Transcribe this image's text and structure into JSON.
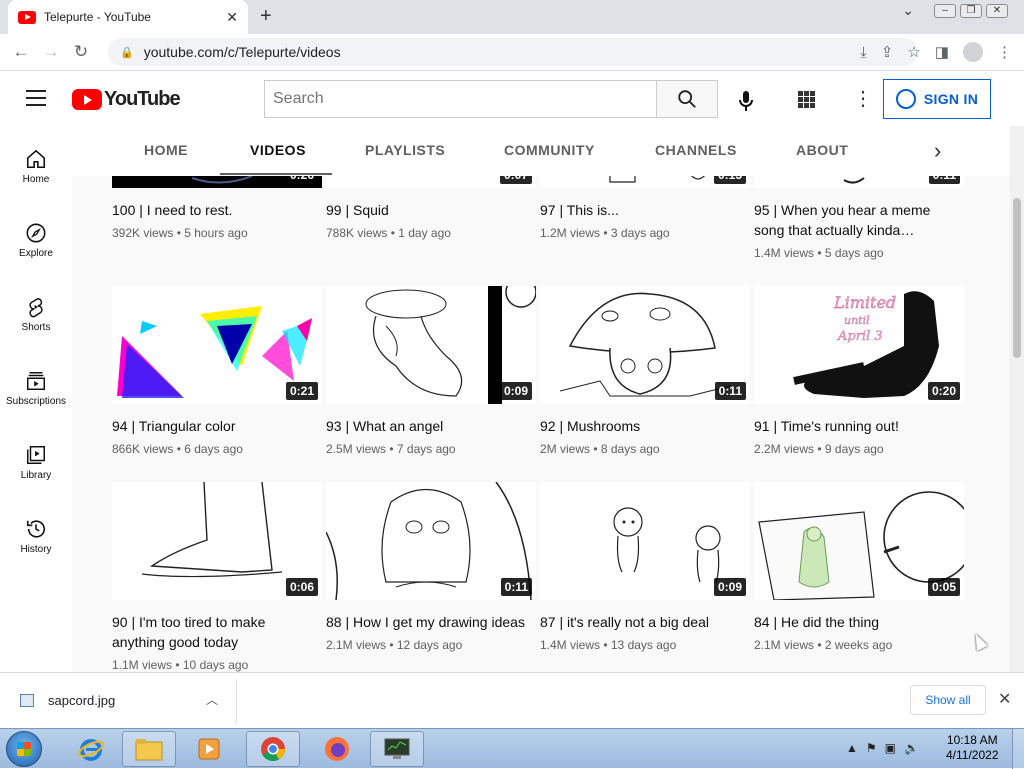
{
  "browser": {
    "tab_title": "Telepurte - YouTube",
    "url": "youtube.com/c/Telepurte/videos"
  },
  "header": {
    "logo_text": "YouTube",
    "search_placeholder": "Search",
    "sign_in_label": "SIGN IN"
  },
  "guide": {
    "items": [
      {
        "label": "Home",
        "icon": "home-icon"
      },
      {
        "label": "Explore",
        "icon": "compass-icon"
      },
      {
        "label": "Shorts",
        "icon": "shorts-icon"
      },
      {
        "label": "Subscriptions",
        "icon": "subscriptions-icon"
      },
      {
        "label": "Library",
        "icon": "library-icon"
      },
      {
        "label": "History",
        "icon": "history-icon"
      }
    ]
  },
  "channel_tabs": [
    "HOME",
    "VIDEOS",
    "PLAYLISTS",
    "COMMUNITY",
    "CHANNELS",
    "ABOUT"
  ],
  "videos": [
    {
      "title": "100 | I need to rest.",
      "meta": "392K views • 5 hours ago",
      "duration": "0:26"
    },
    {
      "title": "99 | Squid",
      "meta": "788K views • 1 day ago",
      "duration": "0:07"
    },
    {
      "title": "97 | This is...",
      "meta": "1.2M views • 3 days ago",
      "duration": "0:13"
    },
    {
      "title": "95 | When you hear a meme song that actually kinda…",
      "meta": "1.4M views • 5 days ago",
      "duration": "0:11"
    },
    {
      "title": "94 | Triangular color",
      "meta": "866K views • 6 days ago",
      "duration": "0:21"
    },
    {
      "title": "93 | What an angel",
      "meta": "2.5M views • 7 days ago",
      "duration": "0:09"
    },
    {
      "title": "92 | Mushrooms",
      "meta": "2M views • 8 days ago",
      "duration": "0:11"
    },
    {
      "title": "91 | Time's running out!",
      "meta": "2.2M views • 9 days ago",
      "duration": "0:20"
    },
    {
      "title": "90 | I'm too tired to make anything good today",
      "meta": "1.1M views • 10 days ago",
      "duration": "0:06"
    },
    {
      "title": "88 | How I get my drawing ideas",
      "meta": "2.1M views • 12 days ago",
      "duration": "0:11"
    },
    {
      "title": "87 | it's really not a big deal",
      "meta": "1.4M views • 13 days ago",
      "duration": "0:09"
    },
    {
      "title": "84 | He did the thing",
      "meta": "2.1M views • 2 weeks ago",
      "duration": "0:05"
    }
  ],
  "thumb_text": {
    "v91_line1": "Limited",
    "v91_line2": "until",
    "v91_line3": "April 3"
  },
  "download_bar": {
    "file_name": "sapcord.jpg",
    "show_all_label": "Show all"
  },
  "taskbar": {
    "time": "10:18 AM",
    "date": "4/11/2022"
  },
  "colors": {
    "youtube_red": "#ff0000",
    "link_blue": "#065fd4"
  }
}
